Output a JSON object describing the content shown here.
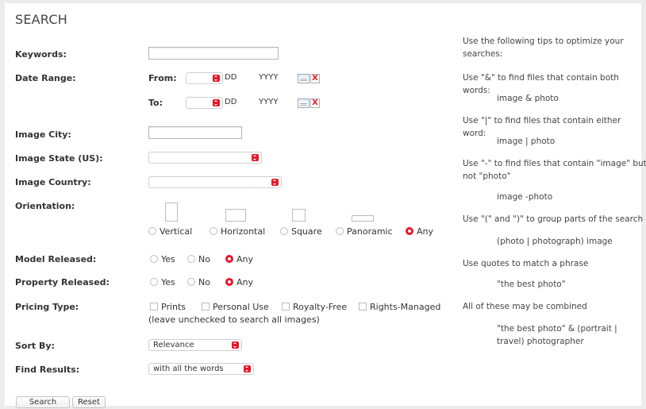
{
  "form": {
    "title": "SEARCH",
    "keywords": {
      "label": "Keywords:",
      "value": ""
    },
    "date_range": {
      "label": "Date Range:",
      "from": {
        "label": "From:",
        "month": "",
        "day": "DD",
        "year": "YYYY",
        "clear": "X"
      },
      "to": {
        "label": "To:",
        "month": "",
        "day": "DD",
        "year": "YYYY",
        "clear": "X"
      }
    },
    "image_city": {
      "label": "Image City:",
      "value": ""
    },
    "image_state": {
      "label": "Image State (US):",
      "value": ""
    },
    "image_country": {
      "label": "Image Country:",
      "value": ""
    },
    "orientation": {
      "label": "Orientation:",
      "options": [
        "Vertical",
        "Horizontal",
        "Square",
        "Panoramic",
        "Any"
      ],
      "selected": "Any"
    },
    "model_released": {
      "label": "Model Released:",
      "options": [
        "Yes",
        "No",
        "Any"
      ],
      "selected": "Any"
    },
    "property_released": {
      "label": "Property Released:",
      "options": [
        "Yes",
        "No",
        "Any"
      ],
      "selected": "Any"
    },
    "pricing_type": {
      "label": "Pricing Type:",
      "options": [
        "Prints",
        "Personal Use",
        "Royalty-Free",
        "Rights-Managed"
      ],
      "note": "(leave unchecked to search all images)"
    },
    "sort_by": {
      "label": "Sort By:",
      "value": "Relevance"
    },
    "find_results": {
      "label": "Find Results:",
      "value": "with all the words"
    },
    "buttons": {
      "search": "Search",
      "reset": "Reset"
    }
  },
  "tips": {
    "intro": "Use the following tips to optimize your searches:",
    "and_tip": "Use \"&\" to find files that contain both words:",
    "and_example": "image & photo",
    "or_tip": "Use \"|\" to find files that contain either word:",
    "or_example": "image | photo",
    "not_tip": "Use \"-\" to find files that contain \"image\" but not \"photo\"",
    "not_example": "image -photo",
    "group_tip": "Use \"(\" and \")\" to group parts of the search",
    "group_example": "(photo | photograph) image",
    "phrase_tip": "Use quotes to match a phrase",
    "phrase_example": "\"the best photo\"",
    "combine_tip": "All of these may be combined",
    "combine_example": "\"the best photo\" & (portrait | travel) photographer"
  },
  "colors": {
    "accent": "#e8162a",
    "panel": "#ffffff",
    "background": "#ececec"
  }
}
